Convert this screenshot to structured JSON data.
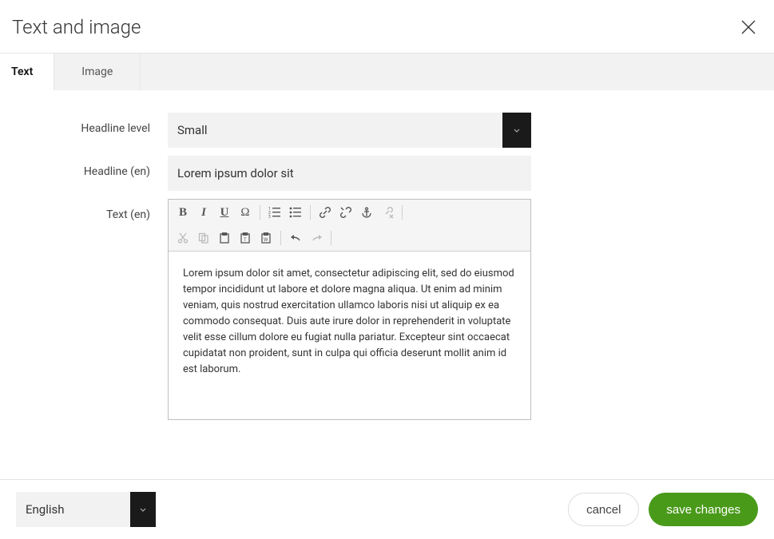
{
  "modal": {
    "title": "Text and image"
  },
  "tabs": {
    "text": "Text",
    "image": "Image"
  },
  "form": {
    "headline_level": {
      "label": "Headline level",
      "value": "Small"
    },
    "headline": {
      "label": "Headline (en)",
      "value": "Lorem ipsum dolor sit"
    },
    "text": {
      "label": "Text (en)",
      "value": "Lorem ipsum dolor sit amet, consectetur adipiscing elit, sed do eiusmod tempor incididunt ut labore et dolore magna aliqua. Ut enim ad minim veniam, quis nostrud exercitation ullamco laboris nisi ut aliquip ex ea commodo consequat. Duis aute irure dolor in reprehenderit in voluptate velit esse cillum dolore eu fugiat nulla pariatur. Excepteur sint occaecat cupidatat non proident, sunt in culpa qui officia deserunt mollit anim id est laborum."
    }
  },
  "toolbar_icons": {
    "bold": "B",
    "italic": "I",
    "underline": "U",
    "special_char": "Ω"
  },
  "footer": {
    "language": "English",
    "cancel": "cancel",
    "save": "save changes"
  }
}
